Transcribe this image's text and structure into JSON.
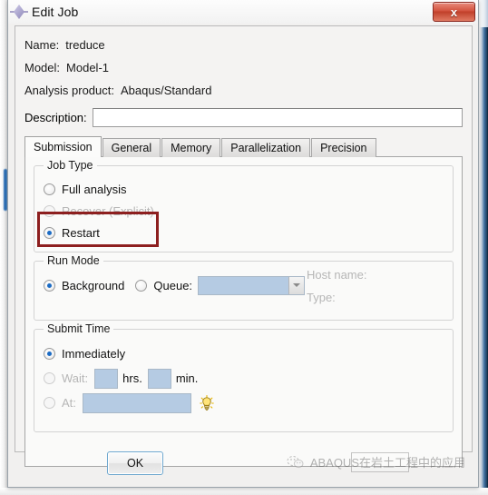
{
  "window": {
    "title": "Edit Job",
    "icon": "abaqus-diamond-icon",
    "close_label": "x"
  },
  "form": {
    "name_label": "Name:",
    "name_value": "treduce",
    "model_label": "Model:",
    "model_value": "Model-1",
    "product_label": "Analysis product:",
    "product_value": "Abaqus/Standard",
    "description_label": "Description:",
    "description_value": "",
    "description_placeholder": ""
  },
  "tabs": [
    {
      "label": "Submission",
      "active": true
    },
    {
      "label": "General",
      "active": false
    },
    {
      "label": "Memory",
      "active": false
    },
    {
      "label": "Parallelization",
      "active": false
    },
    {
      "label": "Precision",
      "active": false
    }
  ],
  "job_type": {
    "legend": "Job Type",
    "options": [
      {
        "label": "Full analysis",
        "selected": false,
        "disabled": false
      },
      {
        "label": "Recover (Explicit)",
        "selected": false,
        "disabled": true
      },
      {
        "label": "Restart",
        "selected": true,
        "disabled": false
      }
    ]
  },
  "run_mode": {
    "legend": "Run Mode",
    "background_label": "Background",
    "background_selected": true,
    "queue_label": "Queue:",
    "queue_selected": false,
    "queue_value": "",
    "host_name_label": "Host name:",
    "type_label": "Type:"
  },
  "submit_time": {
    "legend": "Submit Time",
    "immediately_label": "Immediately",
    "immediately_selected": true,
    "wait_label": "Wait:",
    "wait_selected": false,
    "wait_hrs_value": "",
    "wait_hrs_unit": "hrs.",
    "wait_min_value": "",
    "wait_min_unit": "min.",
    "at_label": "At:",
    "at_selected": false,
    "at_value": "",
    "bulb_icon": "lightbulb-icon"
  },
  "footer": {
    "ok_label": "OK"
  },
  "watermark": {
    "icon": "wechat-icon",
    "text": "ABAQUS在岩土工程中的应用"
  },
  "annotation": {
    "color": "#8d1f1f",
    "target": "Restart"
  }
}
